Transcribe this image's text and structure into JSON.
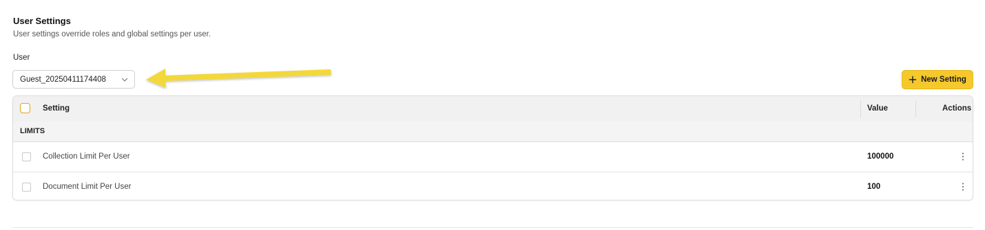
{
  "section": {
    "title": "User Settings",
    "subtitle": "User settings override roles and global settings per user."
  },
  "user": {
    "label": "User",
    "selected": "Guest_20250411174408"
  },
  "toolbar": {
    "new_label": "New Setting",
    "accent": "#f5c82e"
  },
  "table": {
    "columns": {
      "setting": "Setting",
      "value": "Value",
      "actions": "Actions"
    },
    "group": "LIMITS",
    "rows": [
      {
        "name": "Collection Limit Per User",
        "value": "100000"
      },
      {
        "name": "Document Limit Per User",
        "value": "100"
      }
    ]
  },
  "annotation": {
    "arrow_color": "#f2d83b"
  }
}
